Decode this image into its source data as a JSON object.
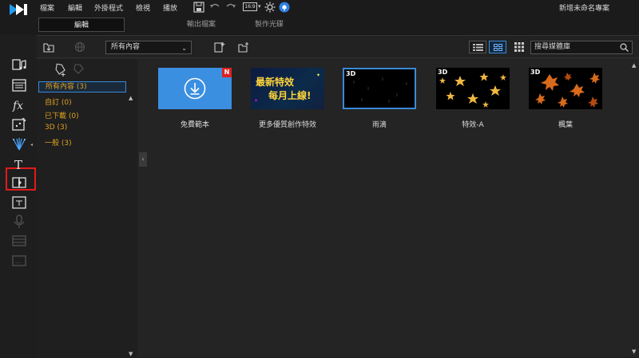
{
  "menu": {
    "items": [
      "檔案",
      "編輯",
      "外掛程式",
      "檢視",
      "播放"
    ],
    "aspect_ratio": "16:9",
    "project_title": "新增未命名專案"
  },
  "mode_tabs": [
    {
      "label": "編輯",
      "active": true
    },
    {
      "label": "輸出檔案",
      "active": false
    },
    {
      "label": "製作光碟",
      "active": false
    }
  ],
  "left_rail": {
    "icons": [
      "media-room-icon",
      "pip-designer-icon",
      "fx-icon",
      "particle-room-icon",
      "particle-effect-icon",
      "title-text-icon",
      "transition-icon",
      "subtitle-icon",
      "voice-record-icon",
      "chapter-icon",
      "more-icon"
    ],
    "selected": "particle-effect-icon"
  },
  "toolbar": {
    "filter_dropdown": "所有內容",
    "search_placeholder": "搜尋媒體庫"
  },
  "tree": {
    "items": [
      {
        "label": "所有內容 (3)",
        "selected": true
      },
      {
        "label": "自訂  (0)",
        "selected": false
      },
      {
        "label": "已下載  (0)",
        "selected": false
      },
      {
        "label": "3D  (3)",
        "selected": false
      },
      {
        "label": "一般  (3)",
        "selected": false
      }
    ]
  },
  "grid": {
    "items": [
      {
        "label": "免費範本",
        "badge": "N",
        "kind": "download"
      },
      {
        "label": "更多優質創作特效",
        "banner_line1": "最新特效",
        "banner_line2": "每月上線!",
        "kind": "promo"
      },
      {
        "label": "雨滴",
        "badge3d": "3D",
        "kind": "rain",
        "selected": true
      },
      {
        "label": "特效-A",
        "badge3d": "3D",
        "kind": "stars"
      },
      {
        "label": "楓葉",
        "badge3d": "3D",
        "kind": "leaves"
      }
    ]
  },
  "colors": {
    "accent_blue": "#3a8ad8",
    "folder_orange": "#e0a020",
    "highlight_red": "#e21b1b",
    "badge_red": "#d22"
  }
}
